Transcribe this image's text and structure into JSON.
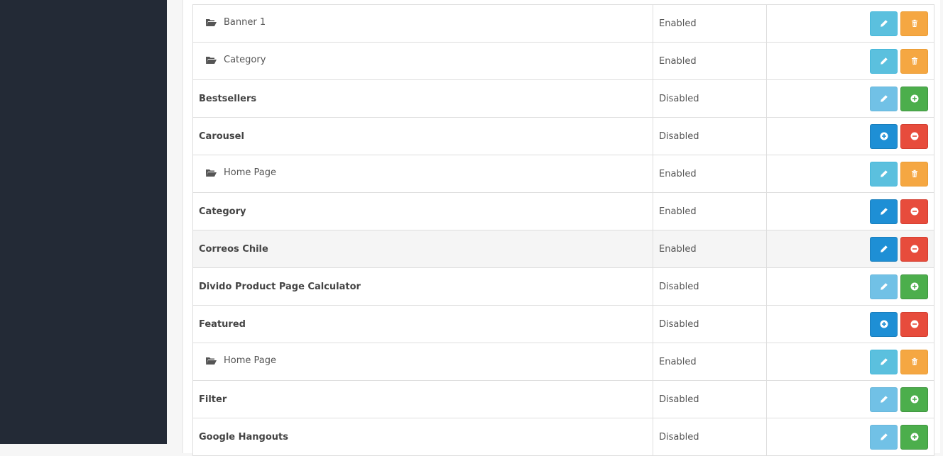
{
  "rows": [
    {
      "name": "Banner 1",
      "status": "Enabled",
      "child": true,
      "actions": [
        "edit",
        "delete"
      ]
    },
    {
      "name": "Category",
      "status": "Enabled",
      "child": true,
      "actions": [
        "edit",
        "delete"
      ]
    },
    {
      "name": "Bestsellers",
      "status": "Disabled",
      "child": false,
      "actions": [
        "edit-disabled",
        "install"
      ]
    },
    {
      "name": "Carousel",
      "status": "Disabled",
      "child": false,
      "actions": [
        "add",
        "uninstall"
      ]
    },
    {
      "name": "Home Page",
      "status": "Enabled",
      "child": true,
      "actions": [
        "edit",
        "delete"
      ]
    },
    {
      "name": "Category",
      "status": "Enabled",
      "child": false,
      "actions": [
        "edit-primary",
        "uninstall"
      ]
    },
    {
      "name": "Correos Chile",
      "status": "Enabled",
      "child": false,
      "hover": true,
      "actions": [
        "edit-primary",
        "uninstall"
      ]
    },
    {
      "name": "Divido Product Page Calculator",
      "status": "Disabled",
      "child": false,
      "actions": [
        "edit-disabled",
        "install"
      ]
    },
    {
      "name": "Featured",
      "status": "Disabled",
      "child": false,
      "actions": [
        "add",
        "uninstall"
      ]
    },
    {
      "name": "Home Page",
      "status": "Enabled",
      "child": true,
      "actions": [
        "edit",
        "delete"
      ]
    },
    {
      "name": "Filter",
      "status": "Disabled",
      "child": false,
      "actions": [
        "edit-disabled",
        "install"
      ]
    },
    {
      "name": "Google Hangouts",
      "status": "Disabled",
      "child": false,
      "actions": [
        "edit-disabled",
        "install"
      ]
    }
  ],
  "icons": {
    "edit": "pencil-icon",
    "delete": "trash-icon",
    "install": "plus-circle-icon",
    "add": "plus-circle-icon",
    "uninstall": "minus-circle-icon",
    "folder": "folder-open-icon"
  },
  "colors": {
    "sidebar": "#232a36",
    "info": "#5bc0de",
    "warning": "#f5a742",
    "success": "#4cae4c",
    "primary": "#1e8fd5",
    "danger": "#e74c3c"
  }
}
